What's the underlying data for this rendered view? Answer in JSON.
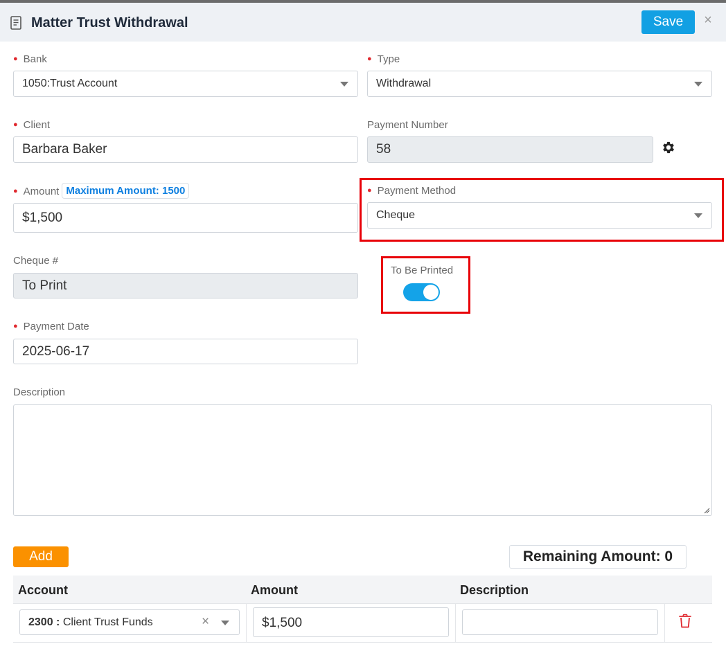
{
  "header": {
    "title": "Matter Trust Withdrawal",
    "save_label": "Save",
    "close_symbol": "×",
    "icon": "document-icon"
  },
  "form": {
    "bank": {
      "label": "Bank",
      "required": true,
      "value": "1050:Trust Account"
    },
    "type": {
      "label": "Type",
      "required": true,
      "value": "Withdrawal"
    },
    "client": {
      "label": "Client",
      "required": true,
      "value": "Barbara Baker"
    },
    "payment_number": {
      "label": "Payment Number",
      "value": "58",
      "icon": "gear-icon"
    },
    "amount": {
      "label": "Amount",
      "required": true,
      "value": "$1,500",
      "max_badge": "Maximum Amount: 1500"
    },
    "payment_method": {
      "label": "Payment Method",
      "required": true,
      "value": "Cheque"
    },
    "cheque_number": {
      "label": "Cheque #",
      "value": "To Print"
    },
    "to_be_printed": {
      "label": "To Be Printed",
      "on": true
    },
    "payment_date": {
      "label": "Payment Date",
      "required": true,
      "value": "2025-06-17"
    },
    "description": {
      "label": "Description",
      "value": ""
    }
  },
  "lines": {
    "add_label": "Add",
    "remaining_label": "Remaining Amount: 0",
    "columns": [
      "Account",
      "Amount",
      "Description"
    ],
    "rows": [
      {
        "account_code": "2300 :",
        "account_name": "Client Trust Funds",
        "clear_symbol": "×",
        "amount": "$1,500",
        "description": ""
      }
    ]
  },
  "colors": {
    "accent": "#12a0e3",
    "add": "#fb9100",
    "required": "#e0282e",
    "highlight": "#e80008",
    "badge_text": "#0d7fe0"
  }
}
